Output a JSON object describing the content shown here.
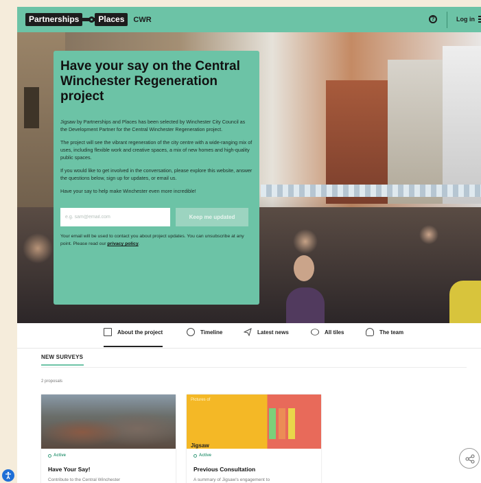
{
  "header": {
    "brand_left": "Partnerships",
    "brand_right": "Places",
    "project_tag": "CWR",
    "help_icon": "help-circle-icon",
    "login_label": "Log in",
    "menu_icon": "hamburger-menu-icon",
    "color": "#6cc3a6"
  },
  "hero": {
    "title": "Have your say on the Central Winchester Regeneration project",
    "paragraphs": [
      "Jigsaw by Partnerships and Places has been selected by Winchester City Council as the Development Partner for the Central Winchester Regeneration project.",
      "The project will see the vibrant regeneration of the city centre with a wide-ranging mix of uses, including flexible work and creative spaces, a mix of new homes and high-quality public spaces.",
      " If you would like to get involved in the conversation, please explore this website, answer the questions below, sign up for updates, or email us.",
      "Have your say to help make Winchester even more incredible!"
    ],
    "email_placeholder": "e.g. sam@email.com",
    "email_value": "",
    "submit_label": "Keep me updated",
    "disclaimer": "Your email will be used to contact you about project updates. You can unsubscribe at any point. Please read our ",
    "privacy_link": "privacy policy",
    "disclaimer_end": "."
  },
  "tabs": [
    {
      "label": "About the project",
      "icon": "document-icon",
      "active": true
    },
    {
      "label": "Timeline",
      "icon": "clock-icon",
      "active": false
    },
    {
      "label": "Latest news",
      "icon": "paper-plane-icon",
      "active": false
    },
    {
      "label": "All tiles",
      "icon": "tiles-icon",
      "active": false
    },
    {
      "label": "The team",
      "icon": "team-icon",
      "active": false
    }
  ],
  "surveys": {
    "heading": "NEW SURVEYS",
    "count": "2 proposals",
    "cards": [
      {
        "status": "Active",
        "title": "Have Your Say!",
        "desc": "Contribute to the Central Winchester",
        "image": "aerial-city-photo"
      },
      {
        "status": "Active",
        "title": "Previous Consultation",
        "desc": "A summary of Jigsaw's engagement to",
        "image": "consultation-photo",
        "image_text": "Pictures of",
        "image_brand": "Jigsaw"
      }
    ]
  },
  "floating": {
    "share_icon": "share-icon",
    "accessibility_icon": "accessibility-icon"
  }
}
